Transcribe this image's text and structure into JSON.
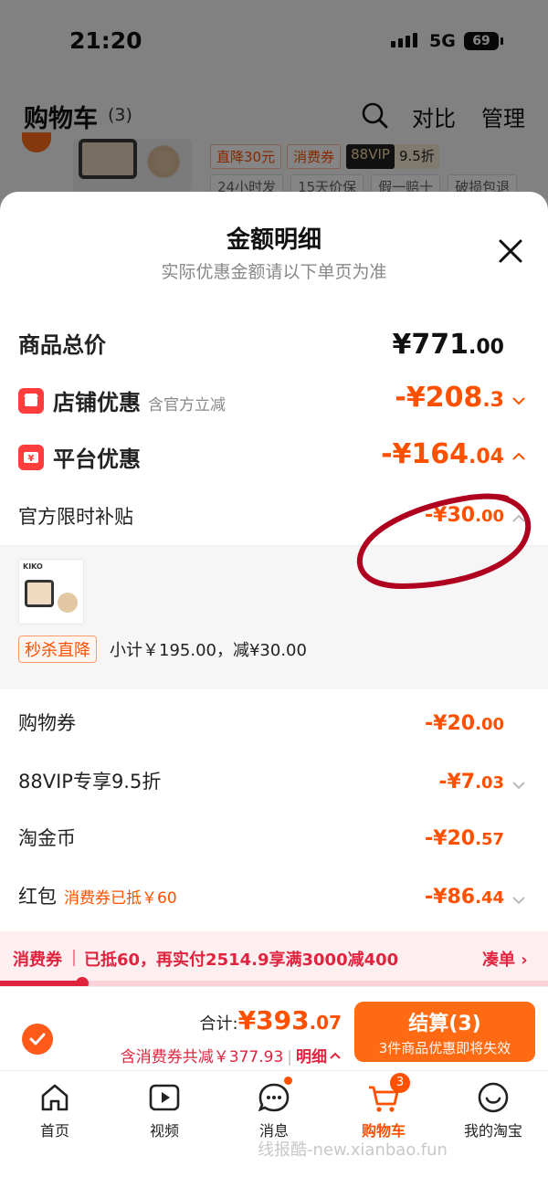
{
  "status": {
    "time": "21:20",
    "network": "5G",
    "battery": "69"
  },
  "cart_header": {
    "title": "购物车",
    "count": "(3)",
    "compare": "对比",
    "manage": "管理"
  },
  "bg_item": {
    "tags": [
      "直降30元",
      "消费券"
    ],
    "vip_logo": "88VIP",
    "vip_rate": "9.5折",
    "service_tags": [
      "24小时发",
      "15天价保",
      "假一赔十",
      "破损包退"
    ]
  },
  "sheet": {
    "title": "金额明细",
    "subtitle": "实际优惠金额请以下单页为准",
    "total_label": "商品总价",
    "total_int": "¥771",
    "total_dec": ".00",
    "shop_discount": {
      "label": "店铺优惠",
      "sub": "含官方立减",
      "int": "-¥208",
      "dec": ".3"
    },
    "platform_discount": {
      "label": "平台优惠",
      "int": "-¥164",
      "dec": ".04"
    },
    "subsidy": {
      "label": "官方限时补贴",
      "int": "-¥30",
      "dec": ".00"
    },
    "product": {
      "brand": "KIKO",
      "promo_tag": "秒杀直降",
      "promo_text": "小计￥195.00，减¥30.00"
    },
    "items": [
      {
        "label": "购物券",
        "int": "-¥20",
        "dec": ".00"
      },
      {
        "label": "88VIP专享9.5折",
        "int": "-¥7",
        "dec": ".03"
      },
      {
        "label": "淘金币",
        "int": "-¥20",
        "dec": ".57"
      },
      {
        "label": "红包",
        "sub": "消费券已抵￥60",
        "int": "-¥86",
        "dec": ".44"
      }
    ]
  },
  "voucher_bar": {
    "label": "消费券",
    "text": "已抵60，再实付2514.9享满3000减400",
    "action": "凑单 ›",
    "progress": 0.15
  },
  "checkout": {
    "total_prefix": "合计:",
    "total_int": "¥393",
    "total_dec": ".07",
    "savings": "含消费券共减￥377.93",
    "detail_link": "明细",
    "button_label": "结算(3)",
    "button_sub": "3件商品优惠即将失效"
  },
  "tabbar": {
    "tabs": [
      {
        "label": "首页",
        "icon": "home-icon"
      },
      {
        "label": "视频",
        "icon": "video-icon"
      },
      {
        "label": "消息",
        "icon": "message-icon"
      },
      {
        "label": "购物车",
        "icon": "cart-icon",
        "badge": "3"
      },
      {
        "label": "我的淘宝",
        "icon": "profile-icon"
      }
    ]
  },
  "watermark": "线报酷-new.xianbao.fun",
  "colors": {
    "accent": "#ff5000",
    "red": "#e0243f",
    "annotation": "#b00020"
  }
}
